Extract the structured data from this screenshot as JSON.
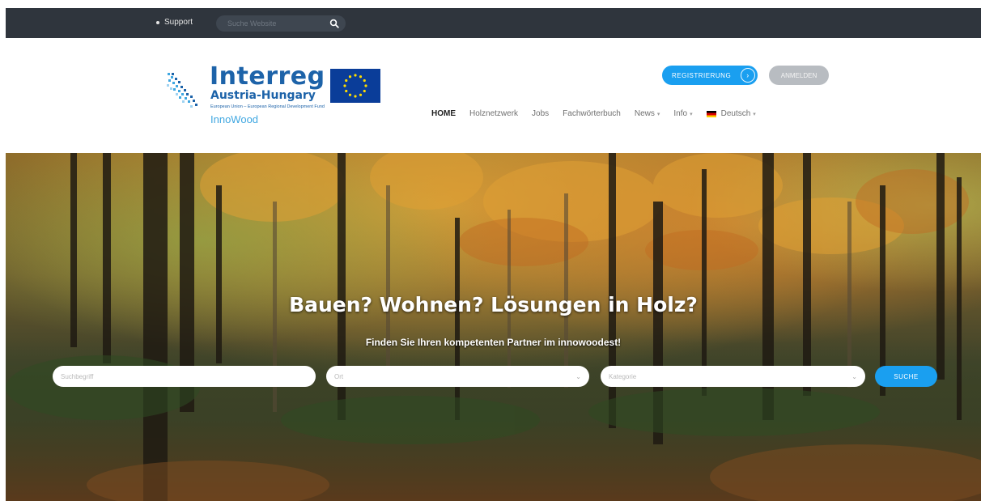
{
  "topbar": {
    "support_label": "Support",
    "search_placeholder": "Suche Website"
  },
  "logo": {
    "title": "Interreg",
    "subtitle": "Austria-Hungary",
    "tagline": "European Union – European Regional Development Fund",
    "project": "InnoWood"
  },
  "auth": {
    "register_label": "REGISTRIERUNG",
    "login_label": "ANMELDEN"
  },
  "nav": {
    "items": [
      {
        "label": "HOME",
        "active": true
      },
      {
        "label": "Holznetzwerk"
      },
      {
        "label": "Jobs"
      },
      {
        "label": "Fachwörterbuch"
      },
      {
        "label": "News",
        "dropdown": true
      },
      {
        "label": "Info",
        "dropdown": true
      },
      {
        "label": "Deutsch",
        "dropdown": true,
        "flag": "de"
      }
    ]
  },
  "hero": {
    "title": "Bauen? Wohnen? Lösungen in Holz?",
    "subtitle": "Finden Sie Ihren kompetenten Partner im innowoodest!",
    "keyword_placeholder": "Suchbegriff",
    "location_placeholder": "Ort",
    "category_placeholder": "Kategorie",
    "search_button": "SUCHE"
  },
  "colors": {
    "topbar": "#2f353d",
    "accent": "#1a9ff0",
    "brand": "#1d63a9",
    "login_button": "#b8bcc1"
  }
}
